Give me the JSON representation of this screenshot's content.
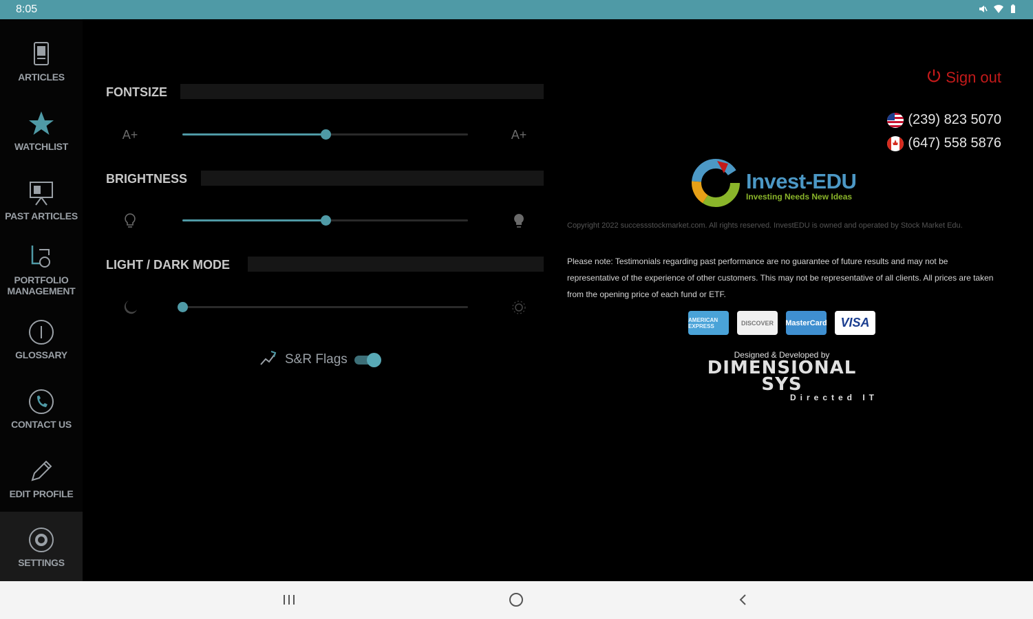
{
  "status_bar": {
    "time": "8:05"
  },
  "sidebar": {
    "items": [
      {
        "label": "ARTICLES",
        "icon": "articles-icon"
      },
      {
        "label": "WATCHLIST",
        "icon": "star-icon"
      },
      {
        "label": "PAST ARTICLES",
        "icon": "presentation-icon"
      },
      {
        "label": "PORTFOLIO MANAGEMENT",
        "icon": "portfolio-icon"
      },
      {
        "label": "GLOSSARY",
        "icon": "info-icon"
      },
      {
        "label": "CONTACT US",
        "icon": "phone-icon"
      },
      {
        "label": "EDIT PROFILE",
        "icon": "pencil-icon"
      },
      {
        "label": "SETTINGS",
        "icon": "gear-icon",
        "active": true
      }
    ]
  },
  "settings": {
    "fontsize": {
      "title": "FONTSIZE",
      "left_glyph": "A+",
      "right_glyph": "A+",
      "value": 0.5
    },
    "brightness": {
      "title": "BRIGHTNESS",
      "value": 0.5
    },
    "mode": {
      "title": "LIGHT / DARK MODE",
      "value": 0.0
    },
    "flags": {
      "label": "S&R Flags",
      "enabled": true
    }
  },
  "account": {
    "signout_label": "Sign out",
    "phone_us": "(239) 823 5070",
    "phone_ca": "(647) 558 5876"
  },
  "brand": {
    "name": "Invest-EDU",
    "tagline": "Investing Needs New Ideas",
    "copyright": "Copyright 2022 successstockmarket.com. All rights reserved. InvestEDU is owned and operated by Stock Market Edu.",
    "note": "Please note: Testimonials regarding past performance are no guarantee of future results and may not be representative of the experience of other customers. This may not be representative of all clients. All prices are taken from the opening price of each fund or ETF."
  },
  "payment_cards": [
    {
      "name": "amex",
      "label": "AMERICAN EXPRESS"
    },
    {
      "name": "discover",
      "label": "DISCOVER"
    },
    {
      "name": "mastercard",
      "label": "MasterCard"
    },
    {
      "name": "visa",
      "label": "VISA"
    }
  ],
  "developer": {
    "caption": "Designed & Developed by",
    "name": "DIMENSIONAL SYS",
    "tagline": "Directed IT"
  },
  "colors": {
    "accent": "#4f9aa6",
    "signout": "#c41a1a",
    "background": "#000000"
  }
}
